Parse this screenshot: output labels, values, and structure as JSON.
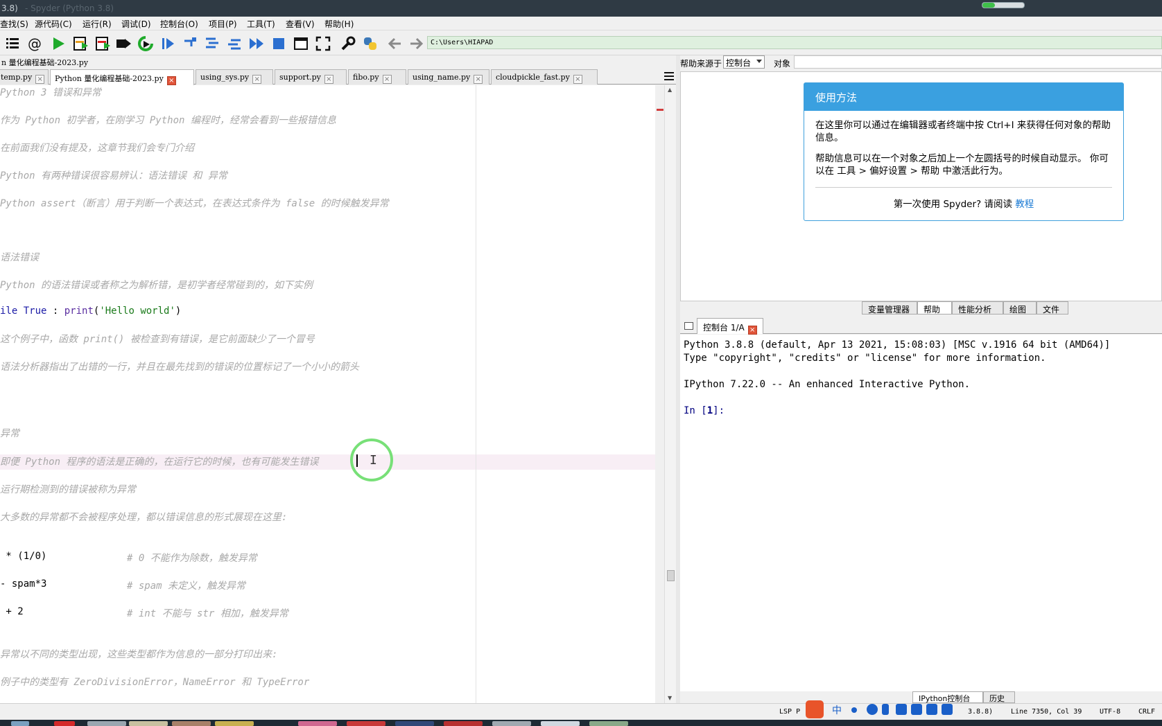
{
  "titlebar": {
    "prefix": "3.8)",
    "faded": "- Spyder (Python 3.8)"
  },
  "menu": [
    "查找(S)",
    "源代码(C)",
    "运行(R)",
    "调试(D)",
    "控制台(O)",
    "项目(P)",
    "工具(T)",
    "查看(V)",
    "帮助(H)"
  ],
  "toolbar": {
    "path": "C:\\Users\\HIAPAD"
  },
  "editor": {
    "file_title": "n 量化编程基础-2023.py",
    "tabs": [
      {
        "label": "temp.py"
      },
      {
        "label": "Python 量化编程基础-2023.py"
      },
      {
        "label": "using_sys.py"
      },
      {
        "label": "support.py"
      },
      {
        "label": "fibo.py"
      },
      {
        "label": "using_name.py"
      },
      {
        "label": "cloudpickle_fast.py"
      }
    ],
    "lines": {
      "l1": "Python 3 错误和异常",
      "l2": "作为 Python 初学者，在刚学习 Python 编程时，经常会看到一些报错信息",
      "l3": "在前面我们没有提及，这章节我们会专门介绍",
      "l4": "Python 有两种错误很容易辨认：语法错误 和 异常",
      "l5": "Python assert（断言）用于判断一个表达式，在表达式条件为 false 的时候触发异常",
      "l6": "语法错误",
      "l7": "Python 的语法错误或者称之为解析错，是初学者经常碰到的，如下实例",
      "l8_a": "ile ",
      "l8_kw": "True",
      "l8_b": " : ",
      "l8_fn": "print",
      "l8_c": "(",
      "l8_str": "'Hello world'",
      "l8_d": ")",
      "l9": "这个例子中，函数 print() 被检查到有错误，是它前面缺少了一个冒号",
      "l10": "语法分析器指出了出错的一行，并且在最先找到的错误的位置标记了一个小小的箭头",
      "l11": "异常",
      "l12": "即便 Python 程序的语法是正确的，在运行它的时候，也有可能发生错误",
      "l13": "运行期检测到的错误被称为异常",
      "l14": "大多数的异常都不会被程序处理，都以错误信息的形式展现在这里:",
      "l15_code": " * (1/0)",
      "l15_cmt": "# 0 不能作为除数，触发异常",
      "l16_code": "- spam*3",
      "l16_cmt": "# spam 未定义，触发异常",
      "l17_code": " + 2",
      "l17_cmt": "# int 不能与 str 相加，触发异常",
      "l18": "异常以不同的类型出现，这些类型都作为信息的一部分打印出来:",
      "l19": "例子中的类型有 ZeroDivisionError，NameError 和 TypeError"
    }
  },
  "help": {
    "source_label": "帮助来源于",
    "source_value": "控制台",
    "object_label": "对象",
    "card_title": "使用方法",
    "p1": "在这里你可以通过在编辑器或者终端中按 Ctrl+I 来获得任何对象的帮助信息。",
    "p2": "帮助信息可以在一个对象之后加上一个左圆括号的时候自动显示。 你可以在 工具 > 偏好设置 > 帮助 中激活此行为。",
    "foot_text": "第一次使用 Spyder? 请阅读",
    "foot_link": "教程"
  },
  "panel_tabs": [
    "变量管理器",
    "帮助",
    "性能分析",
    "绘图",
    "文件"
  ],
  "console": {
    "tab_label": "控制台 1/A",
    "line1": "Python 3.8.8 (default, Apr 13 2021, 15:08:03) [MSC v.1916 64 bit (AMD64)]",
    "line2": "Type \"copyright\", \"credits\" or \"license\" for more information.",
    "line3": "IPython 7.22.0 -- An enhanced Interactive Python.",
    "prompt_in": "In [",
    "prompt_num": "1",
    "prompt_end": "]:"
  },
  "bottom_tabs": [
    "IPython控制台",
    "历史"
  ],
  "status": {
    "lsp": "LSP P",
    "python_ver": "3.8.8)",
    "position": "Line 7350, Col 39",
    "encoding": "UTF-8",
    "eol": "CRLF",
    "ime_text": "中"
  }
}
